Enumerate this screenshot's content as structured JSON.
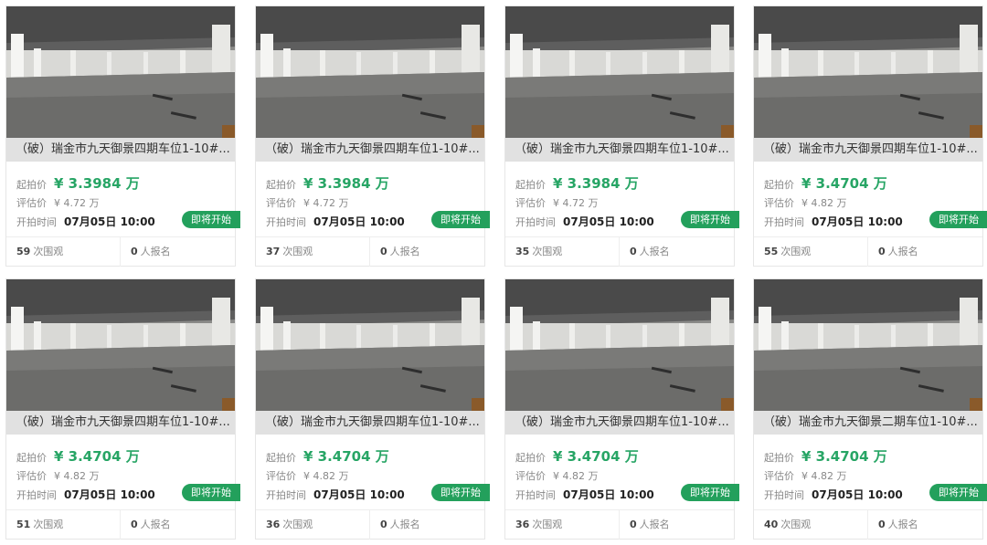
{
  "labels": {
    "start_price": "起拍价",
    "estimate": "评估价",
    "start_time": "开拍时间",
    "views_suffix": "次围观",
    "signups_suffix": "人报名"
  },
  "colors": {
    "price": "#27a565",
    "badge": "#23a05c"
  },
  "listings": [
    {
      "title": "（破）瑞金市九天御景四期车位1-10#...",
      "start_price": "¥ 3.3984 万",
      "estimate": "¥ 4.72 万",
      "start_time": "07月05日 10:00",
      "status": "即将开始",
      "views": "59",
      "signups": "0"
    },
    {
      "title": "（破）瑞金市九天御景四期车位1-10#...",
      "start_price": "¥ 3.3984 万",
      "estimate": "¥ 4.72 万",
      "start_time": "07月05日 10:00",
      "status": "即将开始",
      "views": "37",
      "signups": "0"
    },
    {
      "title": "（破）瑞金市九天御景四期车位1-10#...",
      "start_price": "¥ 3.3984 万",
      "estimate": "¥ 4.72 万",
      "start_time": "07月05日 10:00",
      "status": "即将开始",
      "views": "35",
      "signups": "0"
    },
    {
      "title": "（破）瑞金市九天御景四期车位1-10#...",
      "start_price": "¥ 3.4704 万",
      "estimate": "¥ 4.82 万",
      "start_time": "07月05日 10:00",
      "status": "即将开始",
      "views": "55",
      "signups": "0"
    },
    {
      "title": "（破）瑞金市九天御景四期车位1-10#...",
      "start_price": "¥ 3.4704 万",
      "estimate": "¥ 4.82 万",
      "start_time": "07月05日 10:00",
      "status": "即将开始",
      "views": "51",
      "signups": "0"
    },
    {
      "title": "（破）瑞金市九天御景四期车位1-10#...",
      "start_price": "¥ 3.4704 万",
      "estimate": "¥ 4.82 万",
      "start_time": "07月05日 10:00",
      "status": "即将开始",
      "views": "36",
      "signups": "0"
    },
    {
      "title": "（破）瑞金市九天御景四期车位1-10#...",
      "start_price": "¥ 3.4704 万",
      "estimate": "¥ 4.82 万",
      "start_time": "07月05日 10:00",
      "status": "即将开始",
      "views": "36",
      "signups": "0"
    },
    {
      "title": "（破）瑞金市九天御景二期车位1-10#...",
      "start_price": "¥ 3.4704 万",
      "estimate": "¥ 4.82 万",
      "start_time": "07月05日 10:00",
      "status": "即将开始",
      "views": "40",
      "signups": "0"
    }
  ]
}
